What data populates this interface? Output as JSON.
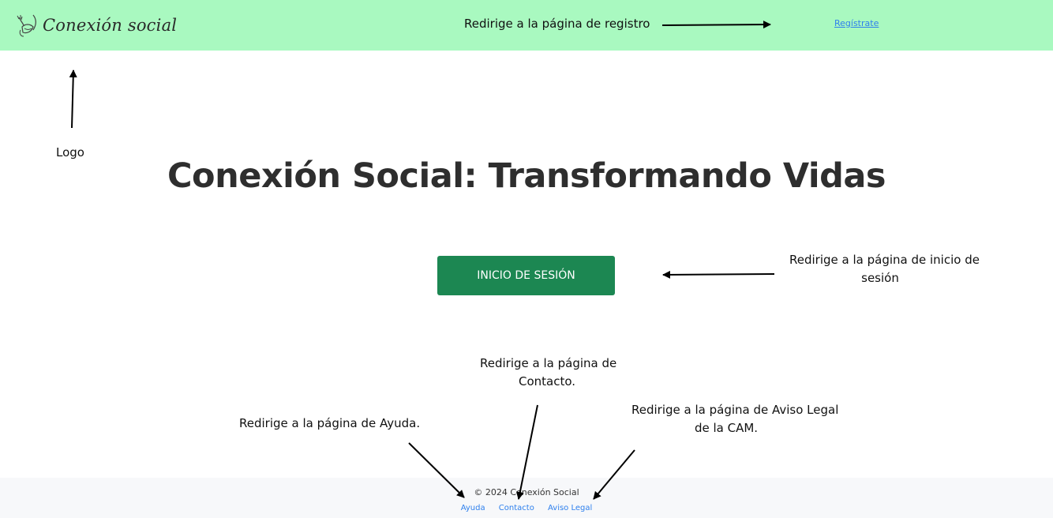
{
  "header": {
    "logo_text": "Conexión social",
    "register_link": "Regístrate"
  },
  "main": {
    "title": "Conexión Social: Transformando Vidas",
    "login_button": "INICIO DE SESIÓN"
  },
  "footer": {
    "copyright": "© 2024 Conexión Social",
    "links": [
      "Ayuda",
      "Contacto",
      "Aviso Legal"
    ]
  },
  "annotations": {
    "register": "Redirige a la página de registro",
    "logo": "Logo",
    "login": [
      "Redirige a la página de inicio de",
      "sesión"
    ],
    "contact": [
      "Redirige a la página de",
      "Contacto."
    ],
    "help": "Redirige a la página de Ayuda.",
    "legal": [
      "Redirige a la página de Aviso Legal",
      "de la CAM."
    ]
  },
  "colors": {
    "header_bg": "#a9f9c0",
    "button_bg": "#1c8752",
    "link": "#2f80ed",
    "footer_bg": "#f7f8fa"
  },
  "icons": {
    "logo_mark": "handshake-icon"
  }
}
